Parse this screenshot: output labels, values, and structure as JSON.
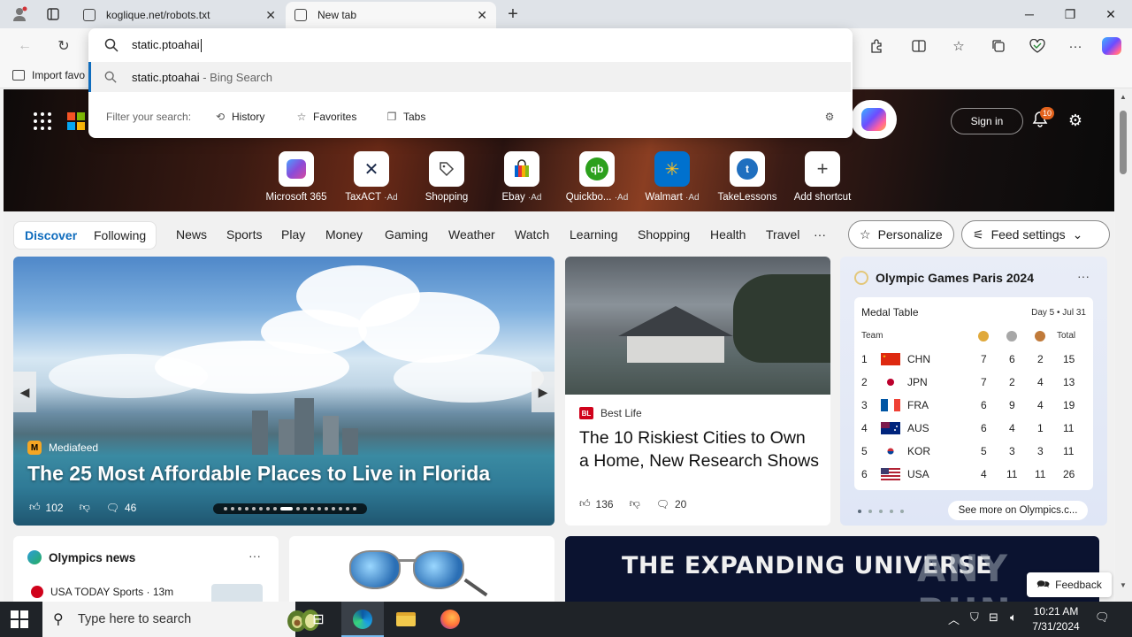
{
  "browser": {
    "tabs": [
      {
        "title": "koglique.net/robots.txt",
        "active": false
      },
      {
        "title": "New tab",
        "active": true
      }
    ],
    "omnibox": {
      "query": "static.ptoahai",
      "suggestion_main": "static.ptoahai",
      "suggestion_suffix": " - Bing Search",
      "filter_label": "Filter your search:",
      "filters": [
        "History",
        "Favorites",
        "Tabs"
      ]
    },
    "favorites_bar": {
      "import_label": "Import favo"
    }
  },
  "newtab": {
    "sign_in": "Sign in",
    "notification_count": "10",
    "shortcuts": [
      {
        "label": "Microsoft 365",
        "ad": "",
        "color": "#7b4fd6"
      },
      {
        "label": "TaxACT",
        "ad": "Ad",
        "color": "#1b2a4a"
      },
      {
        "label": "Shopping",
        "ad": "",
        "color": "#555555"
      },
      {
        "label": "Ebay",
        "ad": "Ad",
        "color": "#e53238"
      },
      {
        "label": "Quickbo...",
        "ad": "Ad",
        "color": "#2ca01c"
      },
      {
        "label": "Walmart",
        "ad": "Ad",
        "color": "#0071ce"
      },
      {
        "label": "TakeLessons",
        "ad": "",
        "color": "#1f6fbf"
      },
      {
        "label": "Add shortcut",
        "ad": "",
        "color": "#444444"
      }
    ],
    "feed_nav": {
      "segments": [
        "Discover",
        "Following"
      ],
      "categories": [
        "News",
        "Sports",
        "Play",
        "Money",
        "Gaming",
        "Weather",
        "Watch",
        "Learning",
        "Shopping",
        "Health",
        "Travel"
      ],
      "more": "···",
      "personalize": "Personalize",
      "feed_settings": "Feed settings"
    },
    "hero_card": {
      "source": "Mediafeed",
      "title": "The 25 Most Affordable Places to Live in Florida",
      "likes": "102",
      "comments": "46"
    },
    "flood_card": {
      "source": "Best Life",
      "title": "The 10 Riskiest Cities to Own a Home, New Research Shows",
      "likes": "136",
      "comments": "20"
    },
    "olympics_card": {
      "title": "Olympic Games Paris 2024",
      "table_title": "Medal Table",
      "day": "Day 5 • Jul 31",
      "header": {
        "team": "Team",
        "total": "Total"
      },
      "rows": [
        {
          "rank": "1",
          "team": "CHN",
          "gold": "7",
          "silver": "6",
          "bronze": "2",
          "total": "15"
        },
        {
          "rank": "2",
          "team": "JPN",
          "gold": "7",
          "silver": "2",
          "bronze": "4",
          "total": "13"
        },
        {
          "rank": "3",
          "team": "FRA",
          "gold": "6",
          "silver": "9",
          "bronze": "4",
          "total": "19"
        },
        {
          "rank": "4",
          "team": "AUS",
          "gold": "6",
          "silver": "4",
          "bronze": "1",
          "total": "11"
        },
        {
          "rank": "5",
          "team": "KOR",
          "gold": "5",
          "silver": "3",
          "bronze": "3",
          "total": "11"
        },
        {
          "rank": "6",
          "team": "USA",
          "gold": "4",
          "silver": "11",
          "bronze": "11",
          "total": "26"
        }
      ],
      "see_more": "See more on Olympics.c..."
    },
    "olympics_news": {
      "title": "Olympics news",
      "item": "USA TODAY Sports · 13m"
    },
    "banner": {
      "title": "THE EXPANDING UNIVERSE",
      "watermark": "ANY RUN"
    },
    "feedback": "Feedback"
  },
  "taskbar": {
    "search_placeholder": "Type here to search",
    "time": "10:21 AM",
    "date": "7/31/2024"
  }
}
